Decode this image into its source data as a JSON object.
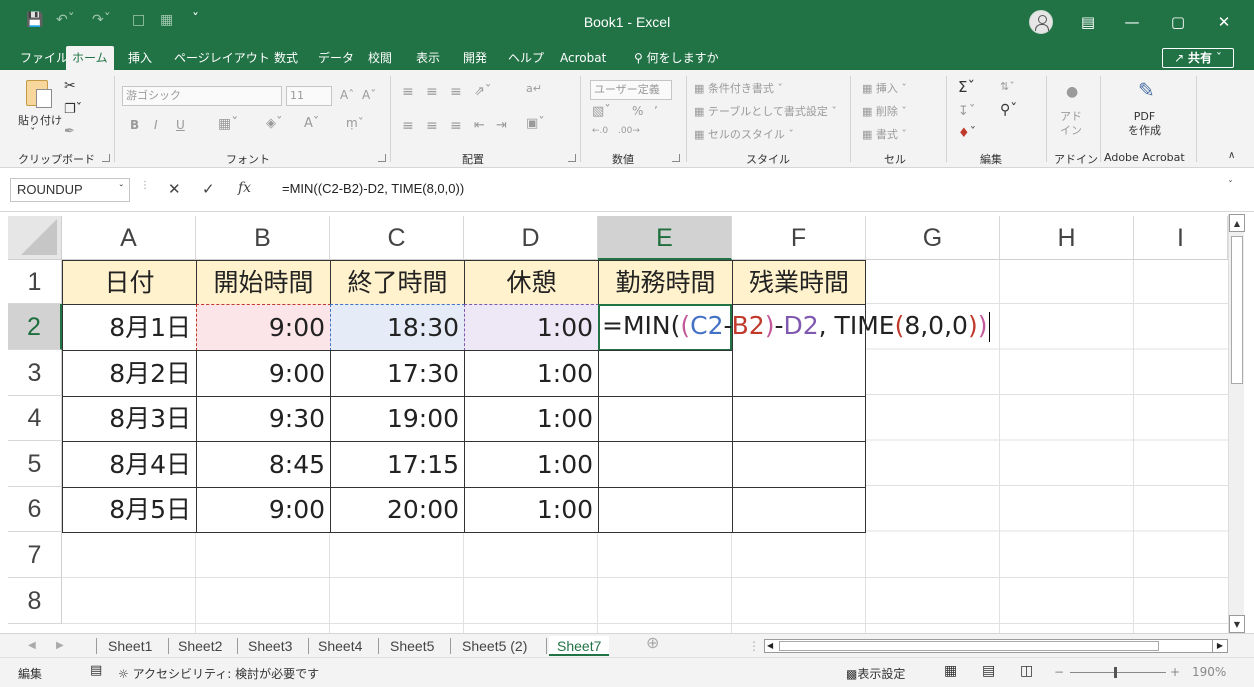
{
  "window": {
    "title": "Book1  -  Excel",
    "controls": {
      "minimize": "—",
      "maximize": "▢",
      "close": "✕",
      "ribbon_display": "▤"
    }
  },
  "quick_access": {
    "save": "🖇",
    "undo": "↶ ˅",
    "redo": "↷ ˅",
    "new": "🗋",
    "table": "▦",
    "more": "˅"
  },
  "menu_tabs": [
    "ファイル",
    "ホーム",
    "挿入",
    "ページレイアウト",
    "数式",
    "データ",
    "校閲",
    "表示",
    "開発",
    "ヘルプ",
    "Acrobat",
    "何をしますか"
  ],
  "share_label": "共有",
  "ribbon": {
    "clipboard": {
      "paste": "貼り付け",
      "label": "クリップボード"
    },
    "font": {
      "name": "游ゴシック",
      "size": "11",
      "label": "フォント",
      "bold": "B",
      "italic": "I",
      "underline": "U"
    },
    "alignment": {
      "label": "配置"
    },
    "number": {
      "format": "ユーザー定義",
      "label": "数値",
      "percent": "%",
      "comma": "’"
    },
    "styles": {
      "conditional": "条件付き書式",
      "as_table": "テーブルとして書式設定",
      "cell_styles": "セルのスタイル",
      "label": "スタイル"
    },
    "cells": {
      "insert": "挿入",
      "delete": "削除",
      "format": "書式",
      "label": "セル"
    },
    "editing": {
      "label": "編集"
    },
    "addins": {
      "button": "アド\nイン",
      "label": "アドイン"
    },
    "acrobat": {
      "button": "PDF\nを作成",
      "label": "Adobe Acrobat"
    }
  },
  "formula_bar": {
    "name_box": "ROUNDUP",
    "formula": "=MIN((C2-B2)-D2, TIME(8,0,0))"
  },
  "columns": [
    "A",
    "B",
    "C",
    "D",
    "E",
    "F",
    "G",
    "H",
    "I"
  ],
  "rows": [
    "1",
    "2",
    "3",
    "4",
    "5",
    "6",
    "7",
    "8"
  ],
  "table": {
    "headers": [
      "日付",
      "開始時間",
      "終了時間",
      "休憩",
      "勤務時間",
      "残業時間"
    ],
    "data": [
      [
        "8月1日",
        "9:00",
        "18:30",
        "1:00"
      ],
      [
        "8月2日",
        "9:00",
        "17:30",
        "1:00"
      ],
      [
        "8月3日",
        "9:30",
        "19:00",
        "1:00"
      ],
      [
        "8月4日",
        "8:45",
        "17:15",
        "1:00"
      ],
      [
        "8月5日",
        "9:00",
        "20:00",
        "1:00"
      ]
    ]
  },
  "editing_cell": {
    "parts": [
      "=MIN(",
      "(",
      "C2",
      "-",
      "B2",
      ")",
      "-",
      "D2",
      ", TIME",
      "(",
      "8,0,0",
      ")",
      ")"
    ],
    "colors": {
      "paren_outer": "#c25a9a",
      "c2": "#4472c4",
      "b2": "#c0392b",
      "d2": "#7f59b0",
      "time_paren": "#c0392b"
    }
  },
  "sheets": [
    "Sheet1",
    "Sheet2",
    "Sheet3",
    "Sheet4",
    "Sheet5",
    "Sheet5 (2)",
    "Sheet7"
  ],
  "active_sheet": "Sheet7",
  "status": {
    "mode": "編集",
    "accessibility": "アクセシビリティ: 検討が必要です",
    "display_settings": "表示設定",
    "zoom": "190%"
  },
  "colors": {
    "brand": "#217346",
    "header_fill": "#fff2cc",
    "b2_highlight": "#fbe5e8",
    "c2_highlight": "#e5ecf7",
    "d2_highlight": "#ede7f6"
  }
}
